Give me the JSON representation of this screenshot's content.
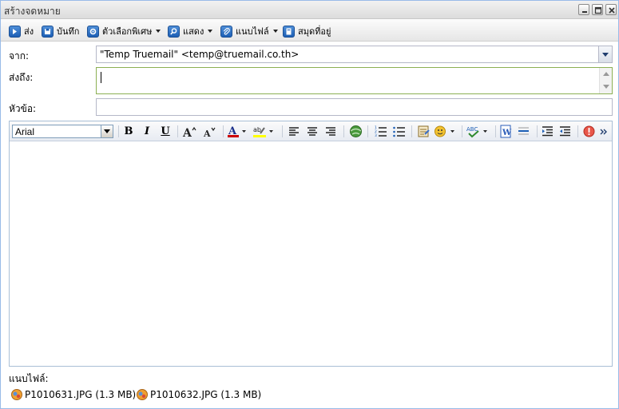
{
  "window": {
    "title": "สร้างจดหมาย",
    "controls": [
      "minimize-icon",
      "maximize-icon",
      "close-icon"
    ]
  },
  "toolbar": {
    "items": [
      {
        "label": "ส่ง",
        "icon": "send-icon",
        "dropdown": false
      },
      {
        "label": "บันทึก",
        "icon": "save-icon",
        "dropdown": false
      },
      {
        "label": "ตัวเลือกพิเศษ",
        "icon": "options-icon",
        "dropdown": true
      },
      {
        "label": "แสดง",
        "icon": "show-icon",
        "dropdown": true
      },
      {
        "label": "แนบไฟล์",
        "icon": "attach-icon",
        "dropdown": true
      },
      {
        "label": "สมุดที่อยู่",
        "icon": "address-book-icon",
        "dropdown": false
      }
    ]
  },
  "form": {
    "from_label": "จาก:",
    "from_value": "\"Temp Truemail\" <temp@truemail.co.th>",
    "to_label": "ส่งถึง:",
    "to_value": "",
    "subject_label": "หัวข้อ:",
    "subject_value": ""
  },
  "editor": {
    "font": "Arial",
    "bold_label": "B",
    "italic_label": "I",
    "underline_label": "U",
    "font_color": "#cc0000",
    "highlight_color": "#ffff00"
  },
  "attachments": {
    "label": "แนบไฟล์:",
    "files": [
      {
        "name": "P1010631.JPG (1.3 MB)"
      },
      {
        "name": "P1010632.JPG (1.3 MB)"
      }
    ]
  }
}
